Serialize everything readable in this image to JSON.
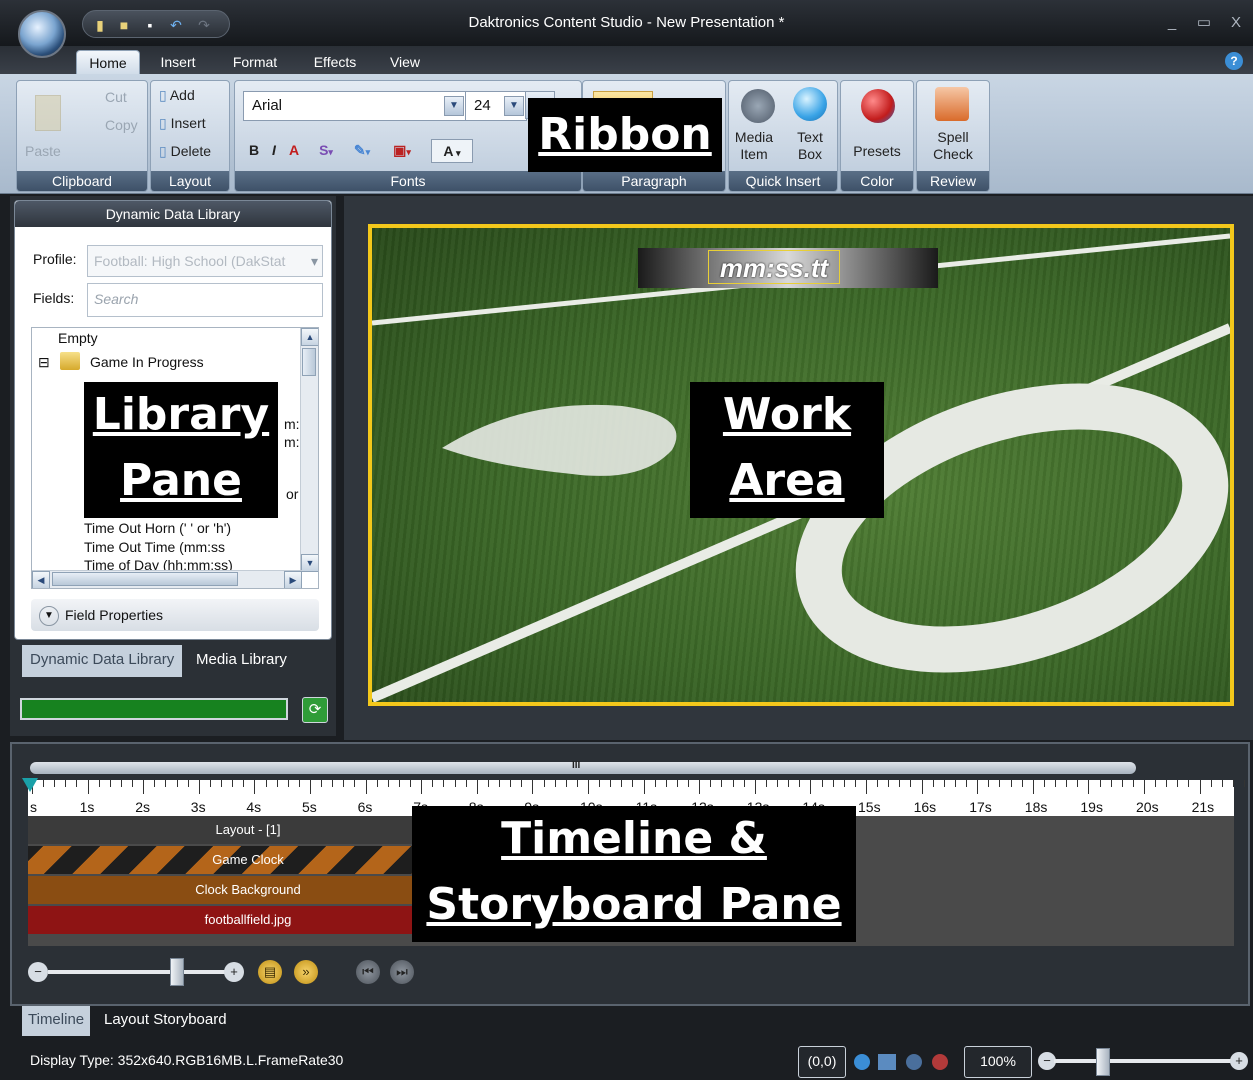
{
  "window": {
    "title": "Daktronics Content Studio - New Presentation *",
    "minimize": "_",
    "maximize": "▭",
    "close": "X"
  },
  "menu_tabs": [
    "Home",
    "Insert",
    "Format",
    "Effects",
    "View"
  ],
  "ribbon": {
    "clipboard": {
      "label": "Clipboard",
      "cut": "Cut",
      "copy": "Copy",
      "paste": "Paste"
    },
    "layout": {
      "label": "Layout",
      "add": "Add",
      "insert": "Insert",
      "delete": "Delete"
    },
    "fonts": {
      "label": "Fonts",
      "font_name": "Arial",
      "font_size": "24",
      "bold": "B",
      "italic": "I",
      "text_color_letter": "A",
      "strike": "S",
      "outline_letter": "A"
    },
    "paragraph": {
      "label": "Paragraph"
    },
    "quick_insert": {
      "label": "Quick Insert",
      "media_item": "Media Item",
      "text_box": "Text Box"
    },
    "color": {
      "label": "Color",
      "presets": "Presets"
    },
    "review": {
      "label": "Review",
      "spell_check": "Spell Check"
    }
  },
  "library": {
    "title": "Dynamic Data Library",
    "profile_label": "Profile:",
    "profile_value": "Football: High School (DakStat",
    "fields_label": "Fields:",
    "search_placeholder": "Search",
    "tree": {
      "empty": "Empty",
      "folder": "Game In Progress",
      "items": [
        "Time Out Horn (' ' or 'h')",
        "Time Out Time (mm:ss",
        "Time of Day (hh:mm:ss)"
      ],
      "partial": [
        "m:",
        "m:",
        "or"
      ]
    },
    "field_properties": "Field Properties",
    "tabs": [
      "Dynamic Data Library",
      "Media Library"
    ]
  },
  "work_area": {
    "clock_text": "mm:ss.tt"
  },
  "timeline": {
    "ruler_labels": [
      "s",
      "1s",
      "2s",
      "3s",
      "4s",
      "5s",
      "6s",
      "7s",
      "8s",
      "9s",
      "10s",
      "11s",
      "12s",
      "13s",
      "14s",
      "15s",
      "16s",
      "17s",
      "18s",
      "19s",
      "20s",
      "21s"
    ],
    "tracks": [
      {
        "name": "Layout - [1]",
        "color": "#3b3b3b"
      },
      {
        "name": "Game Clock",
        "color": "#8a4d12"
      },
      {
        "name": "Clock Background",
        "color": "#8a4d12"
      },
      {
        "name": "footballfield.jpg",
        "color": "#8e1414"
      }
    ],
    "scroll_grip": "III"
  },
  "bottom_tabs": [
    "Timeline",
    "Layout Storyboard"
  ],
  "status": {
    "display_type": "Display Type:  352x640.RGB16MB.L.FrameRate30",
    "coords": "(0,0)",
    "zoom": "100%"
  },
  "callouts": {
    "ribbon": "Ribbon",
    "library_line1": "Library",
    "library_line2": "Pane",
    "work_line1": "Work",
    "work_line2": "Area",
    "timeline_line1": "Timeline &",
    "timeline_line2": "Storyboard Pane"
  },
  "colors": {
    "accent_yellow": "#f3c81b",
    "progress_green": "#17821f",
    "ribbon_blue": "#a8b9cc"
  }
}
